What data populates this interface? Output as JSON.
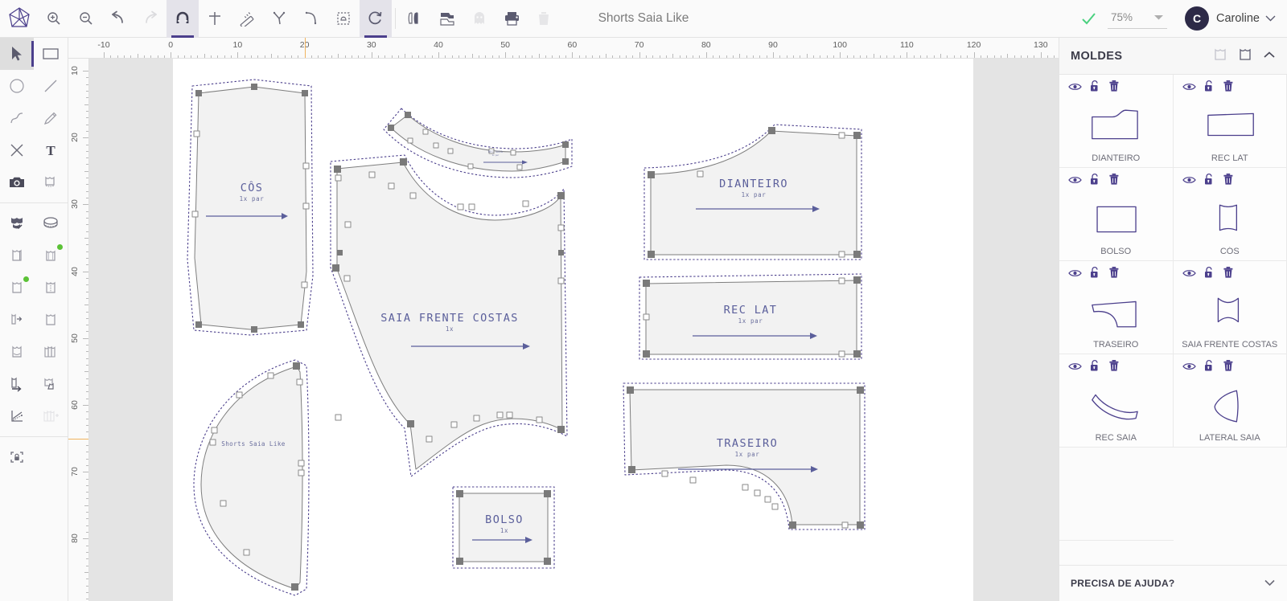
{
  "app": {
    "logo_icon": "geometric-polygon-logo",
    "document_title": "Shorts Saia Like",
    "saved_check_icon": "check-icon",
    "zoom_level": "75%",
    "zoom_caret_icon": "chevron-down-icon",
    "user_initial": "C",
    "user_name": "Caroline",
    "user_caret_icon": "chevron-down-icon"
  },
  "toolbar": {
    "items": [
      {
        "name": "zoom-in-icon",
        "icon": "zoom-in",
        "active": false,
        "disabled": false
      },
      {
        "name": "zoom-out-icon",
        "icon": "zoom-out",
        "active": false,
        "disabled": false
      },
      {
        "name": "undo-icon",
        "icon": "undo",
        "active": false,
        "disabled": false
      },
      {
        "name": "redo-icon",
        "icon": "redo",
        "active": false,
        "disabled": true
      },
      {
        "name": "magnet-snap-icon",
        "icon": "magnet",
        "active": true,
        "disabled": false
      },
      {
        "name": "crosshair-icon",
        "icon": "crosshair",
        "active": false,
        "disabled": false
      },
      {
        "name": "ruler-measure-icon",
        "icon": "ruler",
        "active": false,
        "disabled": false
      },
      {
        "name": "angle-corner-icon",
        "icon": "angle",
        "active": false,
        "disabled": false
      },
      {
        "name": "curve-corner-icon",
        "icon": "curve",
        "active": false,
        "disabled": false
      },
      {
        "name": "bounding-box-icon",
        "icon": "bbox",
        "active": false,
        "disabled": false
      },
      {
        "name": "rotate-icon",
        "icon": "rotate",
        "active": true,
        "disabled": false
      },
      {
        "name": "mirror-fabric-icon",
        "icon": "mirror",
        "active": false,
        "disabled": false
      },
      {
        "name": "nest-layout-icon",
        "icon": "nest",
        "active": false,
        "disabled": false
      },
      {
        "name": "ghost-piece-icon",
        "icon": "ghost",
        "active": false,
        "disabled": true
      },
      {
        "name": "print-icon",
        "icon": "print",
        "active": false,
        "disabled": false
      },
      {
        "name": "trash-icon",
        "icon": "trash",
        "active": false,
        "disabled": true
      }
    ]
  },
  "tools": {
    "items": [
      {
        "name": "tool-select-arrow",
        "icon": "arrow",
        "selected": true,
        "badge": false,
        "faded": false
      },
      {
        "name": "tool-rectangle",
        "icon": "rect",
        "selected": false,
        "badge": false,
        "faded": false
      },
      {
        "name": "tool-circle",
        "icon": "circle",
        "selected": false,
        "badge": false,
        "faded": false
      },
      {
        "name": "tool-line",
        "icon": "line",
        "selected": false,
        "badge": false,
        "faded": false
      },
      {
        "name": "tool-curve",
        "icon": "curve",
        "selected": false,
        "badge": false,
        "faded": false
      },
      {
        "name": "tool-pencil",
        "icon": "pencil",
        "selected": false,
        "badge": false,
        "faded": false
      },
      {
        "name": "tool-delete-point",
        "icon": "cross",
        "selected": false,
        "badge": false,
        "faded": false
      },
      {
        "name": "tool-text",
        "icon": "text",
        "selected": false,
        "badge": false,
        "faded": false
      },
      {
        "name": "tool-camera",
        "icon": "camera",
        "selected": false,
        "badge": false,
        "faded": false
      },
      {
        "name": "tool-measure-garment",
        "icon": "garment-tape",
        "selected": false,
        "badge": false,
        "faded": false
      }
    ],
    "items2": [
      {
        "name": "tool-fill-garment",
        "icon": "garment-fill",
        "selected": false,
        "badge": false,
        "faded": false
      },
      {
        "name": "tool-tape-measure",
        "icon": "tape-roll",
        "selected": false,
        "badge": false,
        "faded": false
      },
      {
        "name": "tool-garment-seam",
        "icon": "garment-seam",
        "selected": false,
        "badge": false,
        "faded": false
      },
      {
        "name": "tool-garment-grade",
        "icon": "garment-grade",
        "selected": false,
        "badge": true,
        "faded": false
      },
      {
        "name": "tool-garment-pleat",
        "icon": "garment-pleat",
        "selected": false,
        "badge": true,
        "faded": false
      },
      {
        "name": "tool-garment-fold",
        "icon": "garment-fold",
        "selected": false,
        "badge": false,
        "faded": false
      },
      {
        "name": "tool-garment-dart",
        "icon": "garment-dart",
        "selected": false,
        "badge": false,
        "faded": false
      },
      {
        "name": "tool-garment-piece",
        "icon": "garment-piece",
        "selected": false,
        "badge": false,
        "faded": false
      },
      {
        "name": "tool-garment-notch",
        "icon": "garment-notch",
        "selected": false,
        "badge": false,
        "faded": false
      },
      {
        "name": "tool-garment-stack",
        "icon": "garment-stack",
        "selected": false,
        "badge": false,
        "faded": false
      },
      {
        "name": "tool-garment-mirror",
        "icon": "garment-mir",
        "selected": false,
        "badge": false,
        "faded": false
      },
      {
        "name": "tool-garment-copy",
        "icon": "garment-copy",
        "selected": false,
        "badge": false,
        "faded": false
      },
      {
        "name": "tool-graph-curve",
        "icon": "graph",
        "selected": false,
        "badge": false,
        "faded": false
      },
      {
        "name": "tool-add-garment-stack",
        "icon": "stack-add",
        "selected": false,
        "badge": false,
        "faded": true
      }
    ],
    "items3": [
      {
        "name": "tool-lock-frame",
        "icon": "lock-frame",
        "selected": false,
        "badge": false,
        "faded": false
      }
    ]
  },
  "rulers": {
    "horizontal": {
      "unit_step": 10,
      "labels": [
        -10,
        0,
        10,
        20,
        30,
        40,
        50,
        60,
        70,
        80,
        90,
        100,
        110,
        120,
        130
      ],
      "guide_value": 20
    },
    "vertical": {
      "unit_step": 10,
      "labels": [
        10,
        20,
        30,
        40,
        50,
        60,
        70,
        80
      ],
      "guide_value": 65
    }
  },
  "canvas": {
    "pieces": [
      {
        "name": "COS",
        "label": "CÔS",
        "qty": "1x par"
      },
      {
        "name": "REC SAIA",
        "label": "REC SAIA",
        "qty": "1x par"
      },
      {
        "name": "SAIA FRENTE COSTAS",
        "label": "SAIA FRENTE COSTAS",
        "qty": "1x"
      },
      {
        "name": "DIANTEIRO",
        "label": "DIANTEIRO",
        "qty": "1x par"
      },
      {
        "name": "REC LAT",
        "label": "REC LAT",
        "qty": "1x par"
      },
      {
        "name": "TRASEIRO",
        "label": "TRASEIRO",
        "qty": "1x par"
      },
      {
        "name": "LATERAL SAIA",
        "label": "Shorts Saia Like",
        "qty": ""
      },
      {
        "name": "BOLSO",
        "label": "BOLSO",
        "qty": "1x"
      }
    ]
  },
  "panel": {
    "title": "MOLDES",
    "head_icons": [
      {
        "name": "add-molde-outline-icon"
      },
      {
        "name": "molde-shape-icon"
      },
      {
        "name": "collapse-chevron-up-icon"
      }
    ],
    "row_icons": [
      {
        "name": "eye-visibility-icon"
      },
      {
        "name": "lock-unlocked-icon"
      },
      {
        "name": "trash-delete-icon"
      }
    ],
    "moldes": [
      {
        "name": "DIANTEIRO",
        "shape": "dianteiro"
      },
      {
        "name": "REC LAT",
        "shape": "reclat"
      },
      {
        "name": "BOLSO",
        "shape": "bolso"
      },
      {
        "name": "CÓS",
        "shape": "cos"
      },
      {
        "name": "TRASEIRO",
        "shape": "traseiro"
      },
      {
        "name": "SAIA FRENTE COSTAS",
        "shape": "saiafc"
      },
      {
        "name": "REC SAIA",
        "shape": "recsaia"
      },
      {
        "name": "LATERAL SAIA",
        "shape": "lateral"
      },
      {
        "name": "",
        "shape": "lateral"
      }
    ],
    "footer": {
      "label": "PRECISA DE AJUDA?",
      "chevron_icon": "chevron-down-icon"
    }
  },
  "colors": {
    "accent": "#4b3f8c",
    "piece_stroke": "#7e7e7e",
    "piece_fill": "#f2f2f2",
    "seam_dash": "#4b3f8c",
    "guide": "#f0b35e",
    "panel_bg": "#fbfbfb",
    "canvas_bg": "#e4e4e4"
  }
}
